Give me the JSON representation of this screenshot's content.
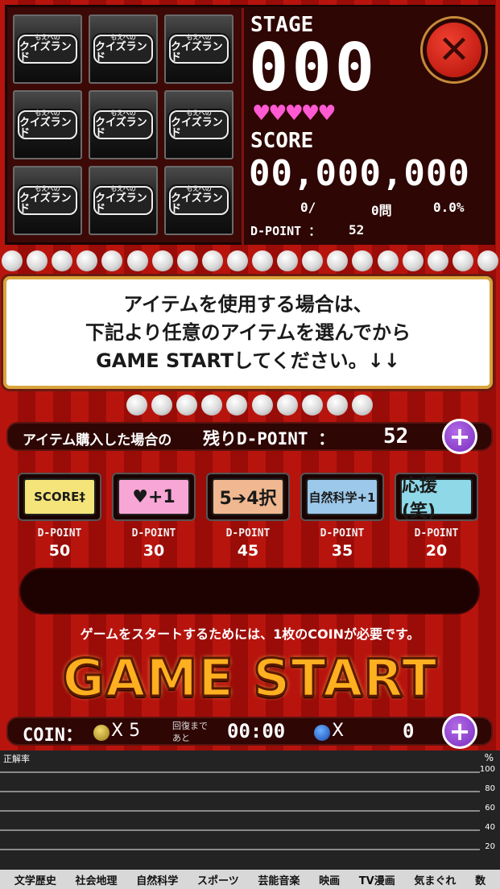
{
  "tiles": {
    "logo_small": "もえへの",
    "logo_main": "クイズランド"
  },
  "stats": {
    "stage_label": "STAGE",
    "stage_value": "000",
    "hearts": "♥♥♥♥♥",
    "score_label": "SCORE",
    "score_value": "00,000,000",
    "correct": "0/",
    "answered": "0問",
    "rate": "0.0%",
    "dpoint_label": "D-POINT ：",
    "dpoint_value": "52"
  },
  "close_glyph": "✕",
  "message": {
    "line1": "アイテムを使用する場合は、",
    "line2": "下記より任意のアイテムを選んでから",
    "line3": "GAME STARTしてください。↓↓"
  },
  "remaining": {
    "label": "アイテム購入した場合の",
    "label2": "残りD-POINT ：",
    "value": "52",
    "plus": "+"
  },
  "items": [
    {
      "label": "SCORE‡",
      "dpoint": "50",
      "color": "#f4e47a"
    },
    {
      "label": "♥+1",
      "dpoint": "30",
      "color": "#f7a6d6"
    },
    {
      "label": "5➔4択",
      "dpoint": "45",
      "color": "#f0b890"
    },
    {
      "label": "自然科学+1",
      "dpoint": "35",
      "color": "#9cc8ea"
    },
    {
      "label": "応援(笑)",
      "dpoint": "20",
      "color": "#8ed8e8"
    }
  ],
  "item_dp_label": "D-POINT",
  "start_note": "ゲームをスタートするためには、1枚のCOINが必要です。",
  "game_start": "GAME START",
  "coin_bar": {
    "label": "COIN：",
    "coin_count": "X 5",
    "recover_label1": "回復まで",
    "recover_label2": "あと",
    "timer": "00:00",
    "blue_count": "X",
    "blue_value": "0",
    "plus": "+"
  },
  "chart": {
    "y_label": "正解率",
    "unit": "%",
    "ticks": [
      "100",
      "80",
      "60",
      "40",
      "20"
    ],
    "series": []
  },
  "categories": [
    "文学歴史",
    "社会地理",
    "自然科学",
    "スポーツ",
    "芸能音楽",
    "映画",
    "TV漫画",
    "気まぐれ",
    "数"
  ]
}
